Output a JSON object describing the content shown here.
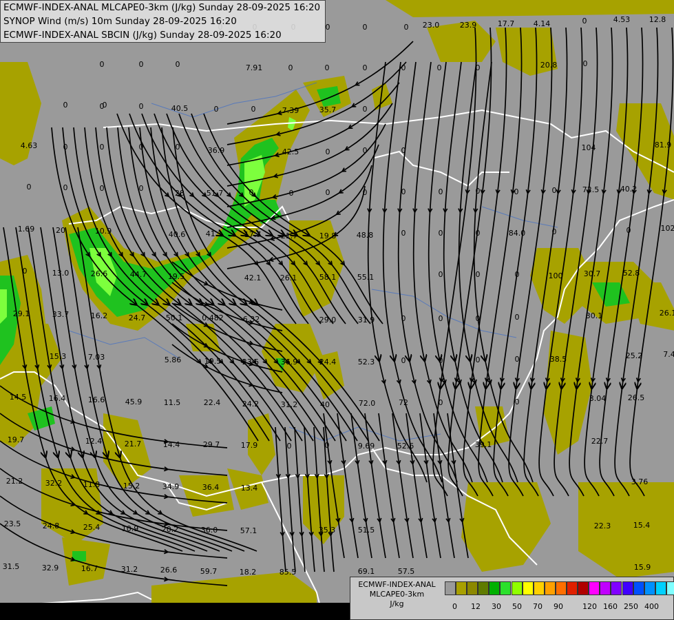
{
  "header": {
    "lines": [
      "ECMWF-INDEX-ANAL MLCAPE0-3km (J/kg) Sunday 28-09-2025 16:20",
      "SYNOP Wind (m/s) 10m Sunday 28-09-2025 16:20",
      "ECMWF-INDEX-ANAL SBCIN (J/kg) Sunday 28-09-2025 16:20"
    ]
  },
  "legend": {
    "title_lines": [
      "ECMWF-INDEX-ANAL",
      "MLCAPE0-3km",
      "J/kg"
    ],
    "colors": [
      "#9a9a9a",
      "#a8a000",
      "#8c8800",
      "#5f7b00",
      "#00b000",
      "#2ce02c",
      "#90ff00",
      "#ffff00",
      "#ffd000",
      "#ffa000",
      "#ff6e00",
      "#e02000",
      "#b00000",
      "#ff00ff",
      "#c000ff",
      "#8000ff",
      "#4000ff",
      "#0050ff",
      "#0090ff",
      "#00d0ff",
      "#80ffff",
      "#ffffff"
    ],
    "tick_labels": [
      "0",
      "12",
      "30",
      "50",
      "70",
      "90",
      "120",
      "160",
      "250",
      "400"
    ],
    "tick_indices": [
      0,
      2,
      4,
      6,
      8,
      10,
      13,
      15,
      17,
      19
    ]
  },
  "map": {
    "values": [
      {
        "t": "23.0"
      },
      {
        "t": "23.9"
      },
      {
        "t": "17.7"
      },
      {
        "t": "4.14"
      },
      {
        "t": "0"
      },
      {
        "t": "4.53"
      },
      {
        "t": "12.8"
      },
      {
        "t": "0"
      },
      {
        "t": "0"
      },
      {
        "t": "0"
      },
      {
        "t": "0"
      },
      {
        "t": "0"
      },
      {
        "t": "0"
      },
      {
        "t": "7.91"
      },
      {
        "t": "0"
      },
      {
        "t": "0"
      },
      {
        "t": "0"
      },
      {
        "t": "0"
      },
      {
        "t": "0"
      },
      {
        "t": "0"
      },
      {
        "t": "20.8"
      },
      {
        "t": "0"
      },
      {
        "t": "0"
      },
      {
        "t": "0"
      },
      {
        "t": "40.5"
      },
      {
        "t": "0"
      },
      {
        "t": "0"
      },
      {
        "t": "7.39"
      },
      {
        "t": "35.7"
      },
      {
        "t": "0"
      },
      {
        "t": "4.63"
      },
      {
        "t": "36.9"
      },
      {
        "t": "42.5"
      },
      {
        "t": "0"
      },
      {
        "t": "0"
      },
      {
        "t": "0"
      },
      {
        "t": "104"
      },
      {
        "t": "81.9"
      },
      {
        "t": "0"
      },
      {
        "t": "28"
      },
      {
        "t": "51.7"
      },
      {
        "t": "0"
      },
      {
        "t": "72.5"
      },
      {
        "t": "40.2"
      },
      {
        "t": "1.69"
      },
      {
        "t": "20"
      },
      {
        "t": "10.9"
      },
      {
        "t": "40.6"
      },
      {
        "t": "41.1"
      },
      {
        "t": "17.7"
      },
      {
        "t": "21.7"
      },
      {
        "t": "19.8"
      },
      {
        "t": "48.8"
      },
      {
        "t": "84.0"
      },
      {
        "t": "102"
      },
      {
        "t": "0"
      },
      {
        "t": "13.0"
      },
      {
        "t": "26.6"
      },
      {
        "t": "44.7"
      },
      {
        "t": "19.5"
      },
      {
        "t": "42.1"
      },
      {
        "t": "26.1"
      },
      {
        "t": "58.1"
      },
      {
        "t": "55.1"
      },
      {
        "t": "100"
      },
      {
        "t": "30.7"
      },
      {
        "t": "52.8"
      },
      {
        "t": "29.1"
      },
      {
        "t": "33.7"
      },
      {
        "t": "16.2"
      },
      {
        "t": "24.7"
      },
      {
        "t": "50.1"
      },
      {
        "t": "0.482"
      },
      {
        "t": "6.32"
      },
      {
        "t": "29.0"
      },
      {
        "t": "31.9"
      },
      {
        "t": "30.1"
      },
      {
        "t": "26.1"
      },
      {
        "t": "15.3"
      },
      {
        "t": "7.03"
      },
      {
        "t": "5.86"
      },
      {
        "t": "19.5"
      },
      {
        "t": "23.5"
      },
      {
        "t": "36.9"
      },
      {
        "t": "24.4"
      },
      {
        "t": "52.3"
      },
      {
        "t": "38.5"
      },
      {
        "t": "25.2"
      },
      {
        "t": "7.4"
      },
      {
        "t": "14.5"
      },
      {
        "t": "16.4"
      },
      {
        "t": "16.6"
      },
      {
        "t": "45.9"
      },
      {
        "t": "11.5"
      },
      {
        "t": "22.4"
      },
      {
        "t": "24.2"
      },
      {
        "t": "31.2"
      },
      {
        "t": "40"
      },
      {
        "t": "72.0"
      },
      {
        "t": "72"
      },
      {
        "t": "3.04"
      },
      {
        "t": "26.5"
      },
      {
        "t": "19.7"
      },
      {
        "t": "12.4"
      },
      {
        "t": "21.7"
      },
      {
        "t": "14.4"
      },
      {
        "t": "29.7"
      },
      {
        "t": "17.9"
      },
      {
        "t": "9.69"
      },
      {
        "t": "52.6"
      },
      {
        "t": "39.1"
      },
      {
        "t": "22.7"
      },
      {
        "t": "21.2"
      },
      {
        "t": "32.2"
      },
      {
        "t": "11.8"
      },
      {
        "t": "15.2"
      },
      {
        "t": "34.9"
      },
      {
        "t": "36.4"
      },
      {
        "t": "13.4"
      },
      {
        "t": "3.76"
      },
      {
        "t": "23.5"
      },
      {
        "t": "24.8"
      },
      {
        "t": "25.4"
      },
      {
        "t": "10.9"
      },
      {
        "t": "20.2"
      },
      {
        "t": "36.0"
      },
      {
        "t": "57.1"
      },
      {
        "t": "35.3"
      },
      {
        "t": "51.5"
      },
      {
        "t": "22.3"
      },
      {
        "t": "15.4"
      },
      {
        "t": "31.5"
      },
      {
        "t": "32.9"
      },
      {
        "t": "16.7"
      },
      {
        "t": "31.2"
      },
      {
        "t": "26.6"
      },
      {
        "t": "59.7"
      },
      {
        "t": "18.2"
      },
      {
        "t": "85.5"
      },
      {
        "t": "69.1"
      },
      {
        "t": "57.5"
      },
      {
        "t": "15.9"
      },
      {
        "t": "0"
      },
      {
        "t": "0"
      },
      {
        "t": "0"
      },
      {
        "t": "0"
      },
      {
        "t": "0"
      },
      {
        "t": "0"
      },
      {
        "t": "0"
      },
      {
        "t": "0"
      },
      {
        "t": "0"
      },
      {
        "t": "0"
      },
      {
        "t": "0"
      },
      {
        "t": "0"
      },
      {
        "t": "0"
      },
      {
        "t": "0"
      },
      {
        "t": "0"
      },
      {
        "t": "0"
      },
      {
        "t": "0"
      },
      {
        "t": "0"
      },
      {
        "t": "0"
      },
      {
        "t": "0"
      },
      {
        "t": "0"
      },
      {
        "t": "0"
      },
      {
        "t": "0"
      },
      {
        "t": "0"
      },
      {
        "t": "0"
      },
      {
        "t": "0"
      },
      {
        "t": "0"
      },
      {
        "t": "0"
      },
      {
        "t": "0"
      },
      {
        "t": "0"
      },
      {
        "t": "0"
      },
      {
        "t": "0"
      },
      {
        "t": "0"
      },
      {
        "t": "0"
      },
      {
        "t": "0"
      },
      {
        "t": "0"
      },
      {
        "t": "0"
      },
      {
        "t": "0"
      },
      {
        "t": "0"
      },
      {
        "t": "0"
      }
    ]
  }
}
